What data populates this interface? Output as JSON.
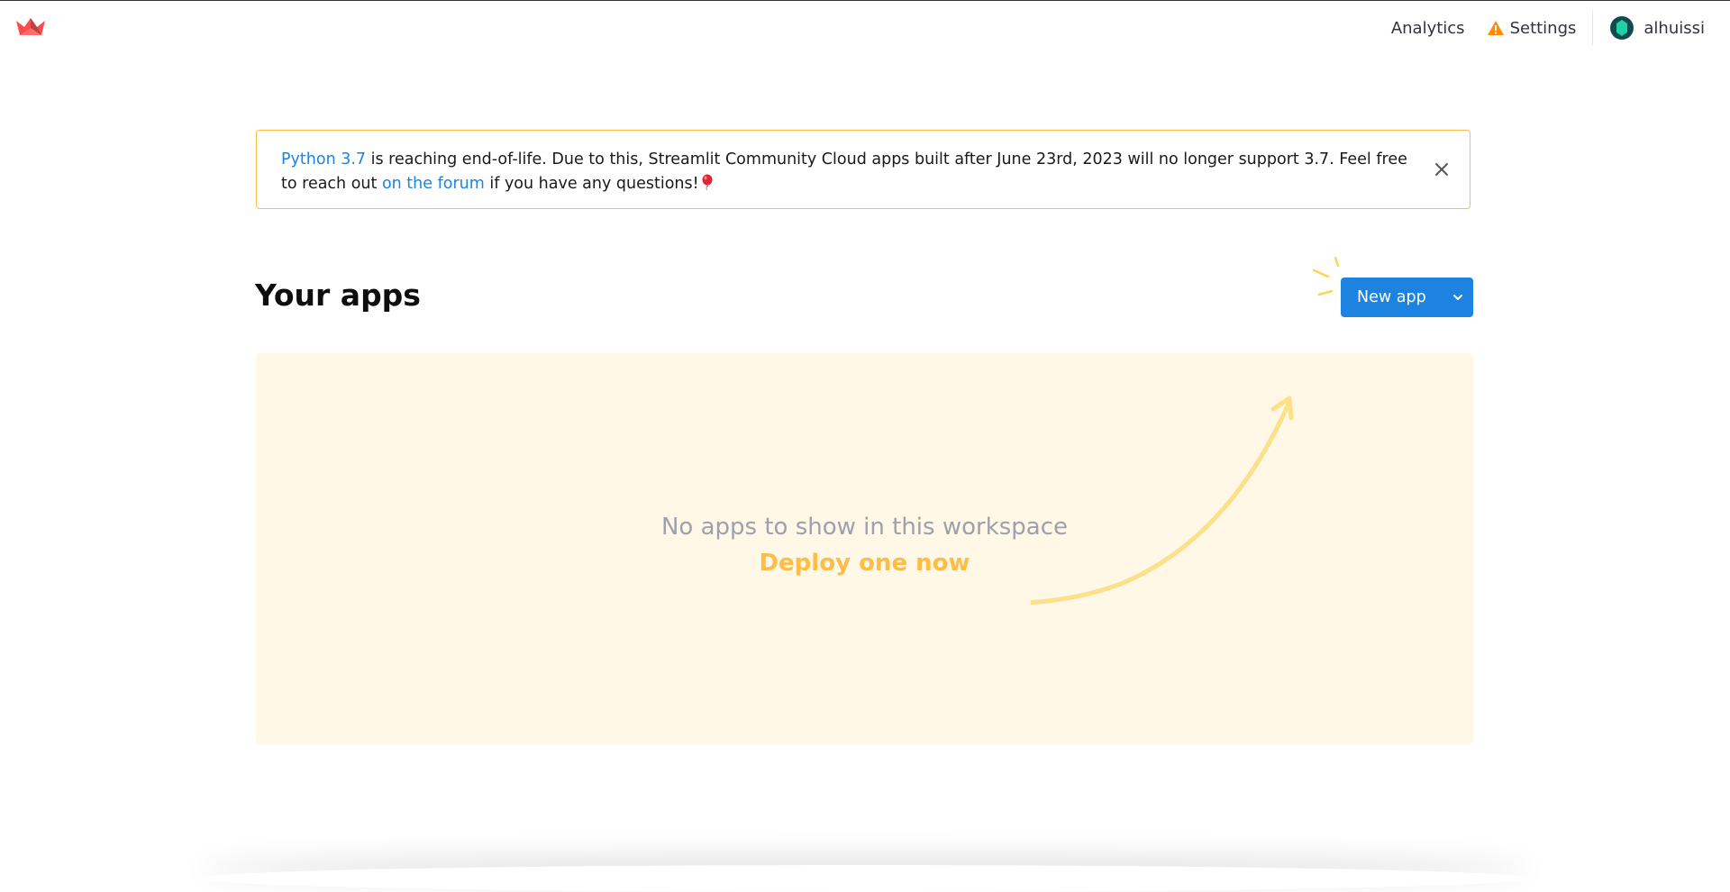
{
  "topbar": {
    "logo_icon": "streamlit-crown-icon",
    "nav": {
      "analytics": "Analytics",
      "settings": "Settings",
      "settings_icon": "warning-icon",
      "username": "alhuissi",
      "avatar_icon": "user-avatar-icon"
    }
  },
  "banner": {
    "link1": "Python 3.7",
    "text1": " is reaching end-of-life. Due to this, Streamlit Community Cloud apps built after June 23rd, 2023 will no longer support 3.7. Feel free to reach out ",
    "link2": "on the forum",
    "text2": " if you have any questions!",
    "emoji_icon": "balloon-icon",
    "close_icon": "close-icon",
    "border_color": "#ffbd45",
    "link_color": "#1c83e1"
  },
  "main": {
    "title": "Your apps",
    "new_app_label": "New app",
    "new_app_color": "#1c83e1"
  },
  "empty_state": {
    "message": "No apps to show in this workspace",
    "cta": "Deploy one now",
    "background": "#fff8e6",
    "cta_color": "#ffbd45"
  }
}
